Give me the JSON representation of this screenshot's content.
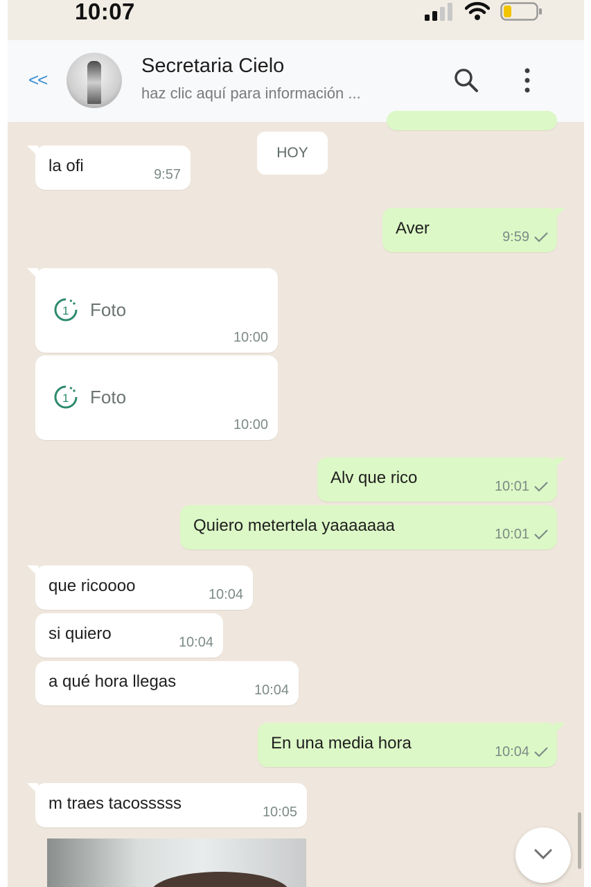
{
  "status_bar": {
    "time": "10:07"
  },
  "header": {
    "back_label": "<<",
    "contact_name": "Secretaria Cielo",
    "subtitle": "haz clic aquí para información ..."
  },
  "day_chip": "HOY",
  "messages": [
    {
      "direction": "in",
      "text": "la ofi",
      "time": "9:57"
    },
    {
      "direction": "out",
      "text": "Aver",
      "time": "9:59"
    },
    {
      "direction": "in",
      "type": "photo",
      "text": "Foto",
      "time": "10:00"
    },
    {
      "direction": "in",
      "type": "photo",
      "text": "Foto",
      "time": "10:00"
    },
    {
      "direction": "out",
      "text": "Alv que rico",
      "time": "10:01"
    },
    {
      "direction": "out",
      "text": "Quiero metertela  yaaaaaaa",
      "time": "10:01"
    },
    {
      "direction": "in",
      "text": "que ricoooo",
      "time": "10:04"
    },
    {
      "direction": "in",
      "text": "si quiero",
      "time": "10:04"
    },
    {
      "direction": "in",
      "text": "a qué hora llegas",
      "time": "10:04"
    },
    {
      "direction": "out",
      "text": "En una media hora",
      "time": "10:04"
    },
    {
      "direction": "in",
      "text": "m traes tacosssss",
      "time": "10:05"
    }
  ],
  "colors": {
    "chat_background": "#efe7dd",
    "outgoing_bubble": "#dcf8c6",
    "incoming_bubble": "#ffffff",
    "link_blue": "#3b8fd1",
    "photo_icon_green": "#2d8a6e"
  },
  "icons": [
    "back-icon",
    "search-icon",
    "menu-icon",
    "photo-timer-icon",
    "check-icon",
    "chevron-down-icon"
  ]
}
